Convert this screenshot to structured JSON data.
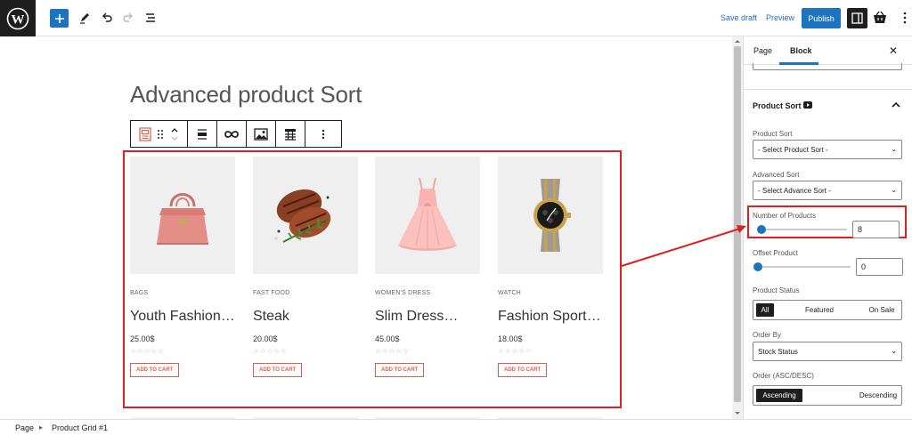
{
  "toolbar": {
    "save_draft": "Save draft",
    "preview": "Preview",
    "publish": "Publish"
  },
  "page": {
    "title": "Advanced product Sort"
  },
  "products": [
    {
      "category": "BAGS",
      "name": "Youth Fashion…",
      "price": "25.00$",
      "cart": "ADD TO CART"
    },
    {
      "category": "FAST FOOD",
      "name": "Steak",
      "price": "20.00$",
      "cart": "ADD TO CART"
    },
    {
      "category": "WOMEN'S DRESS",
      "name": "Slim Dress…",
      "price": "45.00$",
      "cart": "ADD TO CART"
    },
    {
      "category": "WATCH",
      "name": "Fashion Sport…",
      "price": "18.00$",
      "cart": "ADD TO CART"
    }
  ],
  "sidebar": {
    "tabs": [
      "Page",
      "Block"
    ],
    "panel_title": "Product Sort",
    "product_sort": {
      "label": "Product Sort",
      "value": "- Select Product Sort -"
    },
    "advanced_sort": {
      "label": "Advanced Sort",
      "value": "- Select Advance Sort -"
    },
    "number_of_products": {
      "label": "Number of Products",
      "value": "8",
      "fraction": 0.0
    },
    "offset_product": {
      "label": "Offset Product",
      "value": "0",
      "fraction": 0.0
    },
    "product_status": {
      "label": "Product Status",
      "options": [
        "All",
        "Featured",
        "On Sale"
      ],
      "selected": "All"
    },
    "order_by": {
      "label": "Order By",
      "value": "Stock Status"
    },
    "order": {
      "label": "Order (ASC/DESC)",
      "options": [
        "Ascending",
        "Descending"
      ],
      "selected": "Ascending"
    }
  },
  "breadcrumb": {
    "root": "Page",
    "separator": "▸",
    "current": "Product Grid #1"
  },
  "colors": {
    "accent": "#1e73be",
    "highlight": "#e02020",
    "cart": "#e05a4a"
  }
}
